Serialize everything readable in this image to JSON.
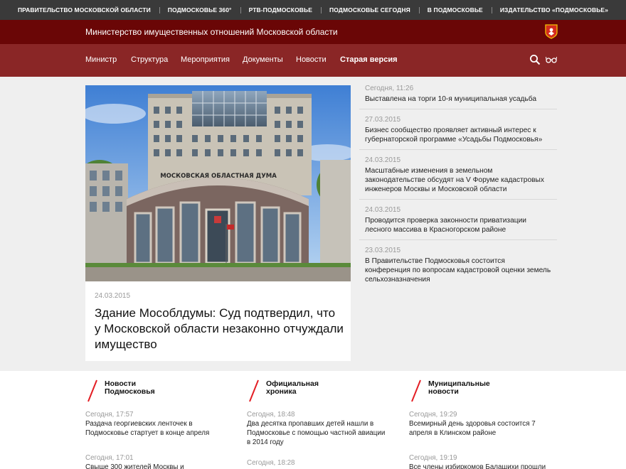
{
  "topbar": {
    "links": [
      "ПРАВИТЕЛЬСТВО МОСКОВСКОЙ ОБЛАСТИ",
      "ПОДМОСКОВЬЕ 360°",
      "РТВ-ПОДМОСКОВЬЕ",
      "ПОДМОСКОВЬЕ СЕГОДНЯ",
      "В ПОДМОСКОВЬЕ",
      "ИЗДАТЕЛЬСТВО «ПОДМОСКОВЬЕ»"
    ]
  },
  "header": {
    "title": "Министерство имущественных отношений Московской области"
  },
  "nav": {
    "items": [
      "Министр",
      "Структура",
      "Мероприятия",
      "Документы",
      "Новости",
      "Старая версия"
    ]
  },
  "hero": {
    "date": "24.03.2015",
    "title": "Здание Мособлдумы: Суд подтвердил, что у Московской области незаконно отчуждали имущество",
    "image_sign": "МОСКОВСКАЯ ОБЛАСТНАЯ ДУМА"
  },
  "feed": [
    {
      "date": "Сегодня, 11:26",
      "text": "Выставлена на торги 10-я муниципальная усадьба"
    },
    {
      "date": "27.03.2015",
      "text": "Бизнес сообщество проявляет активный интерес к губернаторской программе «Усадьбы Подмосковья»"
    },
    {
      "date": "24.03.2015",
      "text": "Масштабные изменения в земельном законодательстве обсудят на V Форуме кадастровых инженеров Москвы и Московской области"
    },
    {
      "date": "24.03.2015",
      "text": "Проводится проверка законности приватизации лесного массива в Красногорском районе"
    },
    {
      "date": "23.03.2015",
      "text": "В Правительстве Подмосковья состоится конференция по вопросам кадастровой оценки земель сельхозназначения"
    }
  ],
  "columns": [
    {
      "title_line1": "Новости",
      "title_line2": "Подмосковья",
      "items": [
        {
          "date": "Сегодня, 17:57",
          "text": "Раздача георгиевских ленточек в Подмосковье стартует в конце апреля"
        },
        {
          "date": "Сегодня, 17:01",
          "text": "Свыше 300 жителей Москвы и"
        }
      ]
    },
    {
      "title_line1": "Официальная",
      "title_line2": "хроника",
      "items": [
        {
          "date": "Сегодня, 18:48",
          "text": "Два десятка пропавших детей нашли в Подмосковье с помощью частной авиации в 2014 году"
        },
        {
          "date": "Сегодня, 18:28",
          "text": ""
        }
      ]
    },
    {
      "title_line1": "Муниципальные",
      "title_line2": "новости",
      "items": [
        {
          "date": "Сегодня, 19:29",
          "text": "Всемирный день здоровья состоится 7 апреля в Клинском районе"
        },
        {
          "date": "Сегодня, 19:19",
          "text": "Все члены избиркомов Балашихи прошли"
        }
      ]
    }
  ],
  "colors": {
    "topbar": "#3a3a3a",
    "titlebar": "#6a0606",
    "nav": "#8a2626",
    "accent_red": "#e31e24"
  }
}
